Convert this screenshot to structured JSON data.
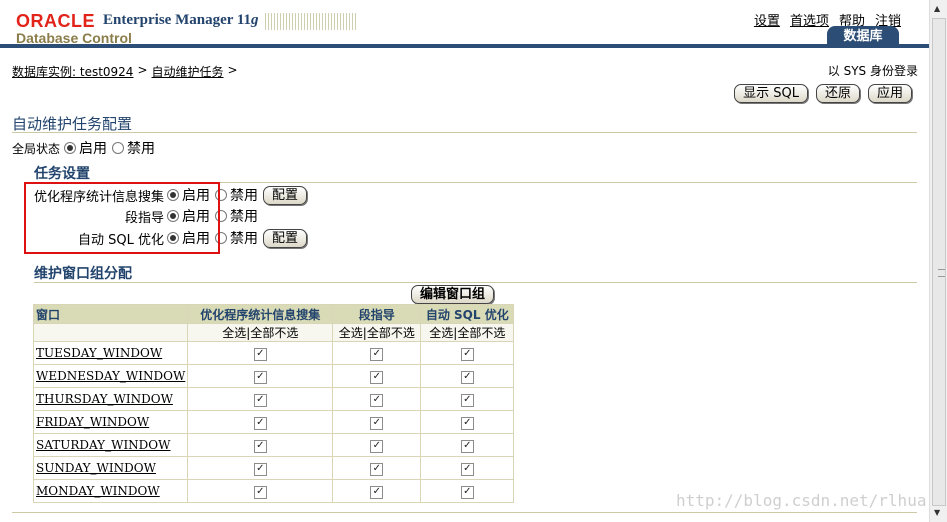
{
  "header": {
    "logo_oracle": "ORACLE",
    "product": "Enterprise Manager 11",
    "product_version": "g",
    "subtitle": "Database Control",
    "links": [
      "设置",
      "首选项",
      "帮助",
      "注销"
    ],
    "tab_label": "数据库"
  },
  "breadcrumb": {
    "instance_link": "数据库实例: test0924",
    "sep1": ">",
    "current_link": "自动维护任务",
    "sep2": ">"
  },
  "login_info": "以 SYS 身份登录",
  "buttons": {
    "show_sql": "显示 SQL",
    "revert": "还原",
    "apply": "应用",
    "configure": "配置",
    "edit_window_group": "编辑窗口组"
  },
  "page_title": "自动维护任务配置",
  "global_status": {
    "label": "全局状态",
    "enable": "启用",
    "disable": "禁用",
    "selected": "enable"
  },
  "task_settings": {
    "title": "任务设置",
    "tasks": [
      {
        "label": "优化程序统计信息搜集",
        "enable": "启用",
        "disable": "禁用",
        "selected": "enable",
        "has_configure": true
      },
      {
        "label": "段指导",
        "enable": "启用",
        "disable": "禁用",
        "selected": "enable",
        "has_configure": false
      },
      {
        "label": "自动 SQL 优化",
        "enable": "启用",
        "disable": "禁用",
        "selected": "enable",
        "has_configure": true
      }
    ]
  },
  "window_group": {
    "title": "维护窗口组分配",
    "columns": [
      "窗口",
      "优化程序统计信息搜集",
      "段指导",
      "自动 SQL 优化"
    ],
    "select_all": "全选",
    "deselect_all": "全部不选",
    "sep": "|",
    "rows": [
      {
        "window": "TUESDAY_WINDOW",
        "values": [
          true,
          true,
          true
        ]
      },
      {
        "window": "WEDNESDAY_WINDOW",
        "values": [
          true,
          true,
          true
        ]
      },
      {
        "window": "THURSDAY_WINDOW",
        "values": [
          true,
          true,
          true
        ]
      },
      {
        "window": "FRIDAY_WINDOW",
        "values": [
          true,
          true,
          true
        ]
      },
      {
        "window": "SATURDAY_WINDOW",
        "values": [
          true,
          true,
          true
        ]
      },
      {
        "window": "SUNDAY_WINDOW",
        "values": [
          true,
          true,
          true
        ]
      },
      {
        "window": "MONDAY_WINDOW",
        "values": [
          true,
          true,
          true
        ]
      }
    ]
  },
  "watermark": "http://blog.csdn.net/rlhua"
}
